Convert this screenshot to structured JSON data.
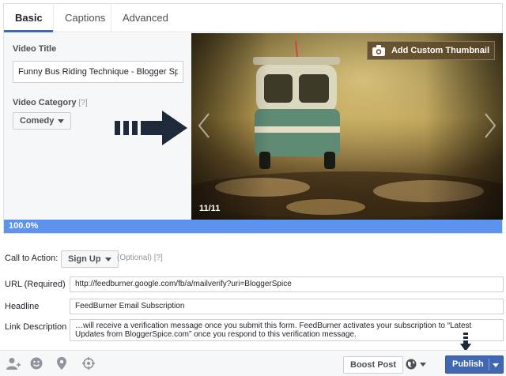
{
  "tabs": [
    {
      "label": "Basic",
      "active": true
    },
    {
      "label": "Captions",
      "active": false
    },
    {
      "label": "Advanced",
      "active": false
    }
  ],
  "video_title": {
    "label": "Video Title",
    "value": "Funny Bus Riding Technique - Blogger Spice"
  },
  "video_category": {
    "label": "Video Category",
    "help": "[?]",
    "selected": "Comedy"
  },
  "thumbnail": {
    "add_label": "Add Custom Thumbnail",
    "counter": "11/11"
  },
  "upload": {
    "progress_text": "100.0%",
    "progress_percent": 100
  },
  "call_to_action": {
    "label": "Call to Action:",
    "selected": "Sign Up",
    "optional": "(Optional)",
    "help": "[?]"
  },
  "url": {
    "label": "URL (Required)",
    "value": "http://feedburner.google.com/fb/a/mailverify?uri=BloggerSpice"
  },
  "headline": {
    "label": "Headline",
    "value": "FeedBurner Email Subscription"
  },
  "link_description": {
    "label": "Link Description",
    "value": "…will receive a verification message once you submit this form. FeedBurner activates your subscription to “Latest Updates from BloggerSpice.com” once you respond to this verification message."
  },
  "bottom_bar": {
    "icons": [
      "tag-people-icon",
      "feeling-icon",
      "location-icon",
      "target-icon"
    ],
    "boost_label": "Boost Post",
    "audience_icon": "globe-icon",
    "publish_label": "Publish"
  },
  "colors": {
    "accent": "#4267b2",
    "progress": "#5b93ef"
  }
}
